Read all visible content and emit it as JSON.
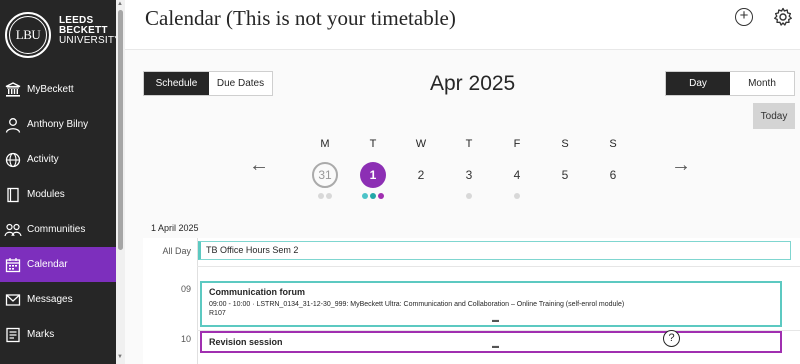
{
  "brand": {
    "logo_text": "LBU",
    "name_line1": "LEEDS",
    "name_line2": "BECKETT",
    "name_line3": "UNIVERSITY"
  },
  "sidebar": {
    "items": [
      {
        "label": "MyBeckett",
        "icon": "institution-icon"
      },
      {
        "label": "Anthony Bilny",
        "icon": "user-icon"
      },
      {
        "label": "Activity",
        "icon": "globe-icon"
      },
      {
        "label": "Modules",
        "icon": "book-icon"
      },
      {
        "label": "Communities",
        "icon": "people-icon"
      },
      {
        "label": "Calendar",
        "icon": "calendar-icon",
        "active": true
      },
      {
        "label": "Messages",
        "icon": "envelope-icon"
      },
      {
        "label": "Marks",
        "icon": "marks-icon"
      }
    ]
  },
  "header": {
    "title": "Calendar (This is not your timetable)",
    "add_symbol": "+"
  },
  "view_tabs": {
    "schedule": "Schedule",
    "due_dates": "Due Dates",
    "selected": "Schedule"
  },
  "range_tabs": {
    "day": "Day",
    "month": "Month",
    "selected": "Day"
  },
  "month_label": "Apr 2025",
  "today_label": "Today",
  "nav": {
    "prev": "←",
    "next": "→"
  },
  "week": [
    {
      "dn": "M",
      "num": "31",
      "state": "past",
      "dots": [
        "grey",
        "grey"
      ]
    },
    {
      "dn": "T",
      "num": "1",
      "state": "today",
      "dots": [
        "teal",
        "teal2",
        "purple"
      ]
    },
    {
      "dn": "W",
      "num": "2",
      "state": "normal",
      "dots": []
    },
    {
      "dn": "T",
      "num": "3",
      "state": "normal",
      "dots": [
        "grey"
      ]
    },
    {
      "dn": "F",
      "num": "4",
      "state": "normal",
      "dots": [
        "grey"
      ]
    },
    {
      "dn": "S",
      "num": "5",
      "state": "normal",
      "dots": []
    },
    {
      "dn": "S",
      "num": "6",
      "state": "normal",
      "dots": []
    }
  ],
  "schedule": {
    "date_label": "1 April 2025",
    "all_day_label": "All Day",
    "hours": [
      "09",
      "10"
    ],
    "all_day_event": "TB Office Hours Sem 2",
    "events": [
      {
        "title": "Communication forum",
        "details": "09:00 - 10:00 ·  LSTRN_0134_31-12-30_999: MyBeckett Ultra: Communication and Collaboration – Online Training (self-enrol module)",
        "location": "R107"
      },
      {
        "title": "Revision session"
      }
    ]
  },
  "help_symbol": "?",
  "colors": {
    "sidebar_bg": "#262626",
    "accent": "#7d2fbd",
    "teal": "#5cc9c1",
    "purple": "#a02fb0"
  }
}
